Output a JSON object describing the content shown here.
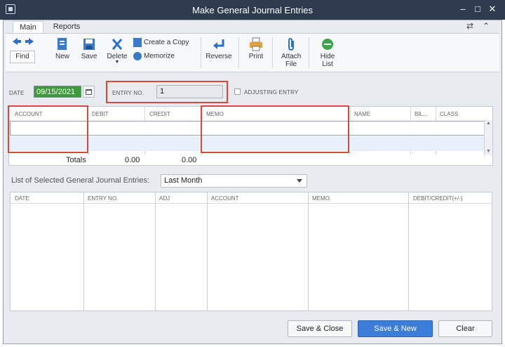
{
  "window": {
    "title": "Make General Journal Entries"
  },
  "tabs": [
    "Main",
    "Reports"
  ],
  "ribbon": {
    "find": "Find",
    "new": "New",
    "save": "Save",
    "delete": "Delete",
    "create_copy": "Create a Copy",
    "memorize": "Memorize",
    "reverse": "Reverse",
    "print": "Print",
    "attach_file": "Attach File",
    "hide_list": "Hide List"
  },
  "header": {
    "date_label": "DATE",
    "date_value": "09/15/2021",
    "entry_no_label": "ENTRY NO.",
    "entry_no_value": "1",
    "adjusting_entry_label": "ADJUSTING ENTRY"
  },
  "grid": {
    "columns": [
      "ACCOUNT",
      "DEBIT",
      "CREDIT",
      "MEMO",
      "NAME",
      "BIL...",
      "CLASS"
    ],
    "totals_label": "Totals",
    "total_debit": "0.00",
    "total_credit": "0.00"
  },
  "list": {
    "label": "List of Selected General Journal Entries:",
    "filter_value": "Last Month",
    "columns": [
      "DATE",
      "ENTRY NO.",
      "ADJ",
      "ACCOUNT",
      "MEMO",
      "DEBIT/CREDIT(+/-)"
    ]
  },
  "buttons": {
    "save_close": "Save & Close",
    "save_new": "Save & New",
    "clear": "Clear"
  },
  "colors": {
    "titlebar": "#2e3b4f",
    "highlight": "#d64a3d",
    "date_field": "#3f9a3d",
    "primary_button": "#3b7dd8"
  }
}
